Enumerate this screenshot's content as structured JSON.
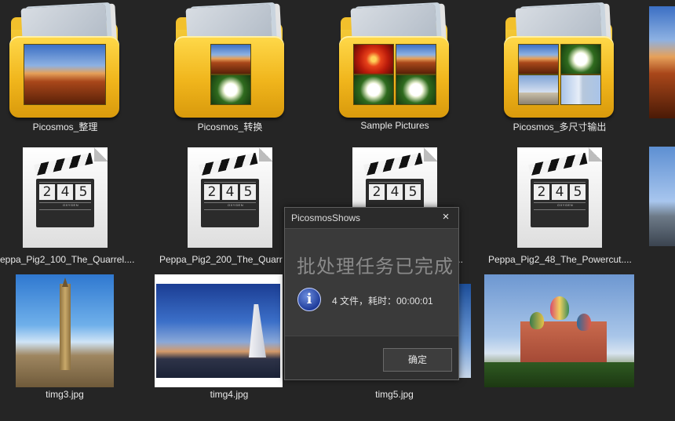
{
  "folders": [
    {
      "label": "Picosmos_整理"
    },
    {
      "label": "Picosmos_转换"
    },
    {
      "label": "Sample Pictures"
    },
    {
      "label": "Picosmos_多尺寸输出"
    }
  ],
  "videos": [
    {
      "label": "eppa_Pig2_100_The_Quarrel...."
    },
    {
      "label": "Peppa_Pig2_200_The_Quarr"
    },
    {
      "label": "..."
    },
    {
      "label": "Peppa_Pig2_48_The_Powercut...."
    }
  ],
  "clapper_digits": [
    "2",
    "4",
    "5"
  ],
  "clapper_brand": "OXYGEN",
  "images": [
    {
      "label": "timg3.jpg"
    },
    {
      "label": "timg4.jpg"
    },
    {
      "label": "timg5.jpg"
    }
  ],
  "dialog": {
    "title": "PicosmosShows",
    "close": "×",
    "heading": "批处理任务已完成",
    "info_glyph": "i",
    "message": "4 文件，耗时：00:00:01",
    "ok_label": "确定"
  },
  "colors": {
    "background": "#252525",
    "folder": "#f0b51c",
    "dialog_bg": "#3a3a3a",
    "info_icon": "#1f3c9a"
  }
}
